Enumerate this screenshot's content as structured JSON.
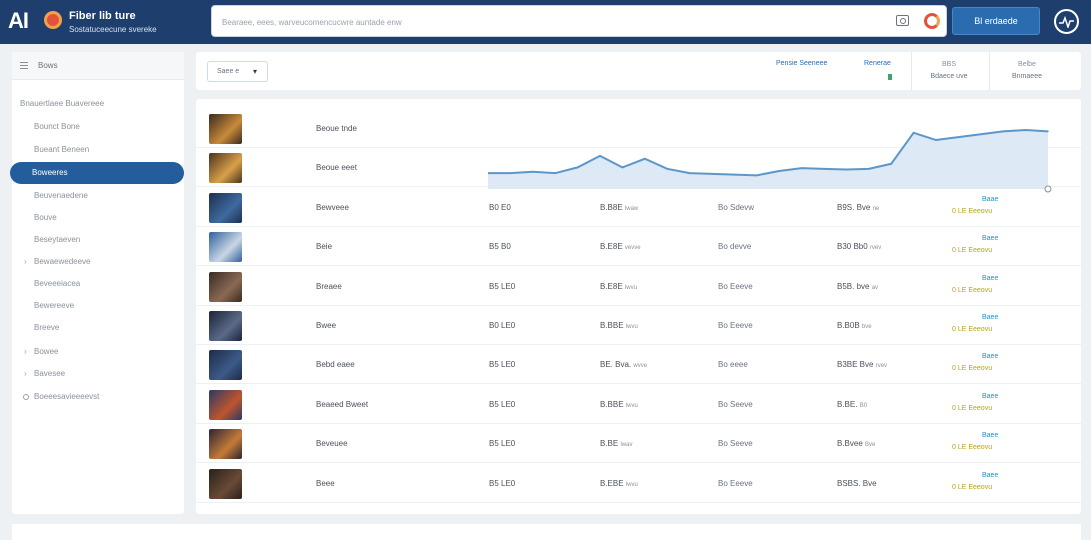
{
  "header": {
    "logo": "AI",
    "brand_title": "Fiber lib ture",
    "brand_subtitle": "Sostatuceecune svereke",
    "search_placeholder": "Bearaee, eees, warveucomencucwre auntade enw",
    "action_button": "Bl erdaede"
  },
  "sidebar": {
    "header": "Bows",
    "items": [
      {
        "label": "Bnauertlaee Buavereee",
        "type": "section"
      },
      {
        "label": "Bounct Bone",
        "type": "item"
      },
      {
        "label": "Bueant Beneen",
        "type": "item"
      },
      {
        "label": "Boweeres",
        "type": "item",
        "active": true
      },
      {
        "label": "Beuvenaedene",
        "type": "item"
      },
      {
        "label": "Bouve",
        "type": "item"
      },
      {
        "label": "Beseytaeven",
        "type": "item"
      },
      {
        "label": "Bewaewedeeve",
        "type": "group"
      },
      {
        "label": "Beveeeiacea",
        "type": "item"
      },
      {
        "label": "Bewereeve",
        "type": "item"
      },
      {
        "label": "Breeve",
        "type": "item"
      },
      {
        "label": "Bowee",
        "type": "group"
      },
      {
        "label": "Bavesee",
        "type": "group"
      },
      {
        "label": "Boeeesavieeeevst",
        "type": "settings"
      }
    ]
  },
  "filterbar": {
    "select_value": "Saee e",
    "links": [
      "Pensie Seeneee",
      "Renerae"
    ],
    "stats": [
      {
        "top": "BBS",
        "bottom": "Bdaece uve"
      },
      {
        "top": "Belbe",
        "bottom": "Bnmaeee"
      }
    ]
  },
  "chart_data": {
    "type": "area",
    "series": [
      {
        "values": [
          22,
          22,
          24,
          22,
          30,
          46,
          30,
          42,
          28,
          22,
          21,
          20,
          19,
          25,
          29,
          28,
          27,
          28,
          35,
          78,
          68,
          72,
          76,
          80,
          82,
          80
        ]
      }
    ],
    "ylim": [
      0,
      100
    ],
    "grid": false,
    "colors": {
      "line": "#5b97c9",
      "fill": "#dde9f5"
    }
  },
  "rows": [
    {
      "name": "Beoue tnde",
      "col2": "",
      "col3": "",
      "col3s": "",
      "col4": "",
      "col5": "",
      "col5s": "",
      "s1": "",
      "s2": "",
      "thumb": [
        "#3b2a1e",
        "#c98a3a"
      ]
    },
    {
      "name": "Beoue eeet",
      "col2": "",
      "col3": "",
      "col3s": "",
      "col4": "",
      "col5": "",
      "col5s": "",
      "s1": "",
      "s2": "",
      "thumb": [
        "#4a3220",
        "#d9a048"
      ]
    },
    {
      "name": "Bewveee",
      "col2": "B0 E0",
      "col3": "B.B8E",
      "col3s": "lwaw",
      "col4": "Bo Sdevw",
      "col5": "B9S. Bve",
      "col5s": "ne",
      "s1": "Baae",
      "s2": "0 LE Eeeovu",
      "thumb": [
        "#1d2f4d",
        "#3f6aa0"
      ]
    },
    {
      "name": "Beie",
      "col2": "B5 B0",
      "col3": "B.E8E",
      "col3s": "vevve",
      "col4": "Bo devve",
      "col5": "B30 Bb0",
      "col5s": "rvev",
      "s1": "Baee",
      "s2": "0 LE Eeeovu",
      "thumb": [
        "#2f5f9e",
        "#c9d6e4"
      ]
    },
    {
      "name": "Breaee",
      "col2": "B5 LE0",
      "col3": "B.E8E",
      "col3s": "lwvu",
      "col4": "Bo Eeeve",
      "col5": "B5B. bve",
      "col5s": "av",
      "s1": "Baee",
      "s2": "0 LE Eeeovu",
      "thumb": [
        "#3a2a22",
        "#8a6a55"
      ]
    },
    {
      "name": "Bwee",
      "col2": "B0 LE0",
      "col3": "B.BBE",
      "col3s": "lwvu",
      "col4": "Bo Eeeve",
      "col5": "B.B0B",
      "col5s": "bve",
      "s1": "Baee",
      "s2": "0 LE Eeeovu",
      "thumb": [
        "#1c2436",
        "#5a6a88"
      ]
    },
    {
      "name": "Bebd eaee",
      "col2": "B5 LE0",
      "col3": "BE. Bva.",
      "col3s": "wvve",
      "col4": "Bo eeee",
      "col5": "B3BE Bve",
      "col5s": "rvev",
      "s1": "Baee",
      "s2": "0 LE Eeeovu",
      "thumb": [
        "#1d2c46",
        "#3c5a88"
      ]
    },
    {
      "name": "Beaeed Bweet",
      "col2": "B5 LE0",
      "col3": "B.BBE",
      "col3s": "lwvu",
      "col4": "Bo Seeve",
      "col5": "B.BE.",
      "col5s": "B0",
      "s1": "Baee",
      "s2": "0 LE Eeeovu",
      "thumb": [
        "#2a3a66",
        "#c0542e"
      ]
    },
    {
      "name": "Beveuee",
      "col2": "B5 LE0",
      "col3": "B.BE",
      "col3s": "lwav",
      "col4": "Bo Seeve",
      "col5": "B.Bvee",
      "col5s": "Bve",
      "s1": "Baee",
      "s2": "0 LE Eeeovu",
      "thumb": [
        "#2b2433",
        "#c57a38"
      ]
    },
    {
      "name": "Beee",
      "col2": "B5 LE0",
      "col3": "B.EBE",
      "col3s": "lwvu",
      "col4": "Bo Eeeve",
      "col5": "BSBS. Bve",
      "col5s": "",
      "s1": "Baee",
      "s2": "0 LE Eeeovu",
      "thumb": [
        "#2a211b",
        "#6a4a36"
      ]
    }
  ]
}
